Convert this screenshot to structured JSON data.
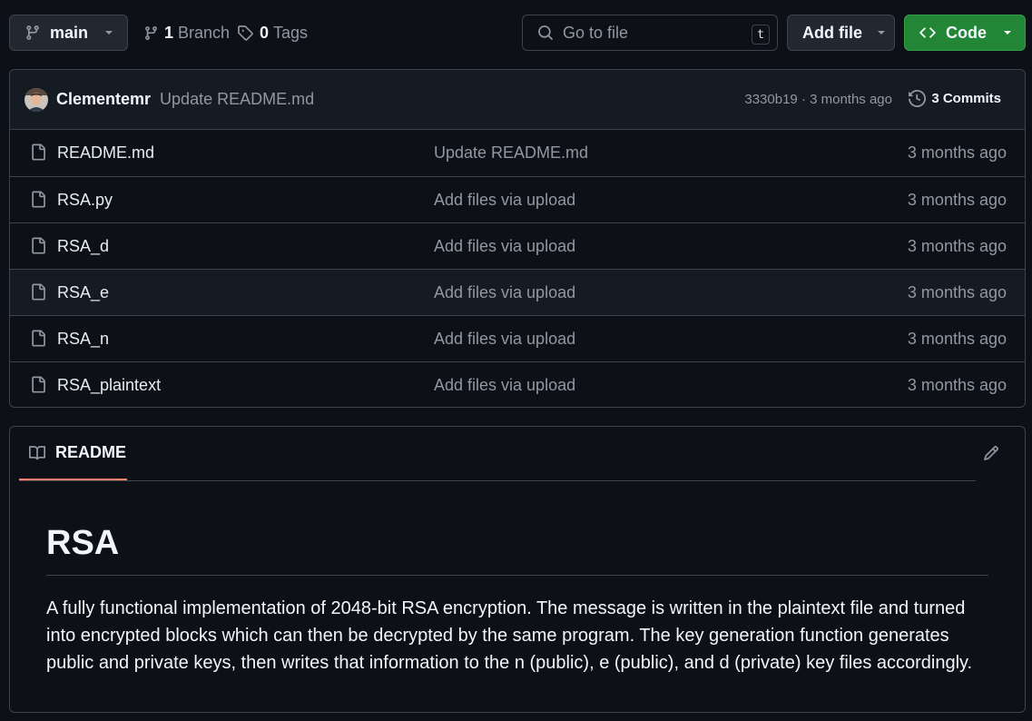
{
  "toolbar": {
    "branch": "main",
    "branch_count": "1",
    "branch_label": "Branch",
    "tag_count": "0",
    "tag_label": "Tags",
    "search_placeholder": "Go to file",
    "search_shortcut": "t",
    "add_file_label": "Add file",
    "code_label": "Code"
  },
  "latest_commit": {
    "author": "Clementemr",
    "message": "Update README.md",
    "hash_time": "3330b19 · 3 months ago",
    "commits_label": "3 Commits"
  },
  "files": [
    {
      "name": "README.md",
      "message": "Update README.md",
      "age": "3 months ago"
    },
    {
      "name": "RSA.py",
      "message": "Add files via upload",
      "age": "3 months ago"
    },
    {
      "name": "RSA_d",
      "message": "Add files via upload",
      "age": "3 months ago"
    },
    {
      "name": "RSA_e",
      "message": "Add files via upload",
      "age": "3 months ago"
    },
    {
      "name": "RSA_n",
      "message": "Add files via upload",
      "age": "3 months ago"
    },
    {
      "name": "RSA_plaintext",
      "message": "Add files via upload",
      "age": "3 months ago"
    }
  ],
  "readme": {
    "tab_label": "README",
    "title": "RSA",
    "body": "A fully functional implementation of 2048-bit RSA encryption. The message is written in the plaintext file and turned into encrypted blocks which can then be decrypted by the same program. The key generation function generates public and private keys, then writes that information to the n (public), e (public), and d (private) key files accordingly."
  },
  "icons": {
    "branch": "git-branch-icon",
    "tag": "tag-icon",
    "search": "search-icon",
    "code": "code-icon",
    "history": "history-icon",
    "file": "file-icon",
    "book": "book-icon",
    "edit": "pencil-icon"
  },
  "colors": {
    "background": "#0d1117",
    "border": "#3d444d",
    "code_button": "#238636",
    "tab_underline": "#f78166",
    "muted_text": "#9198a1"
  }
}
